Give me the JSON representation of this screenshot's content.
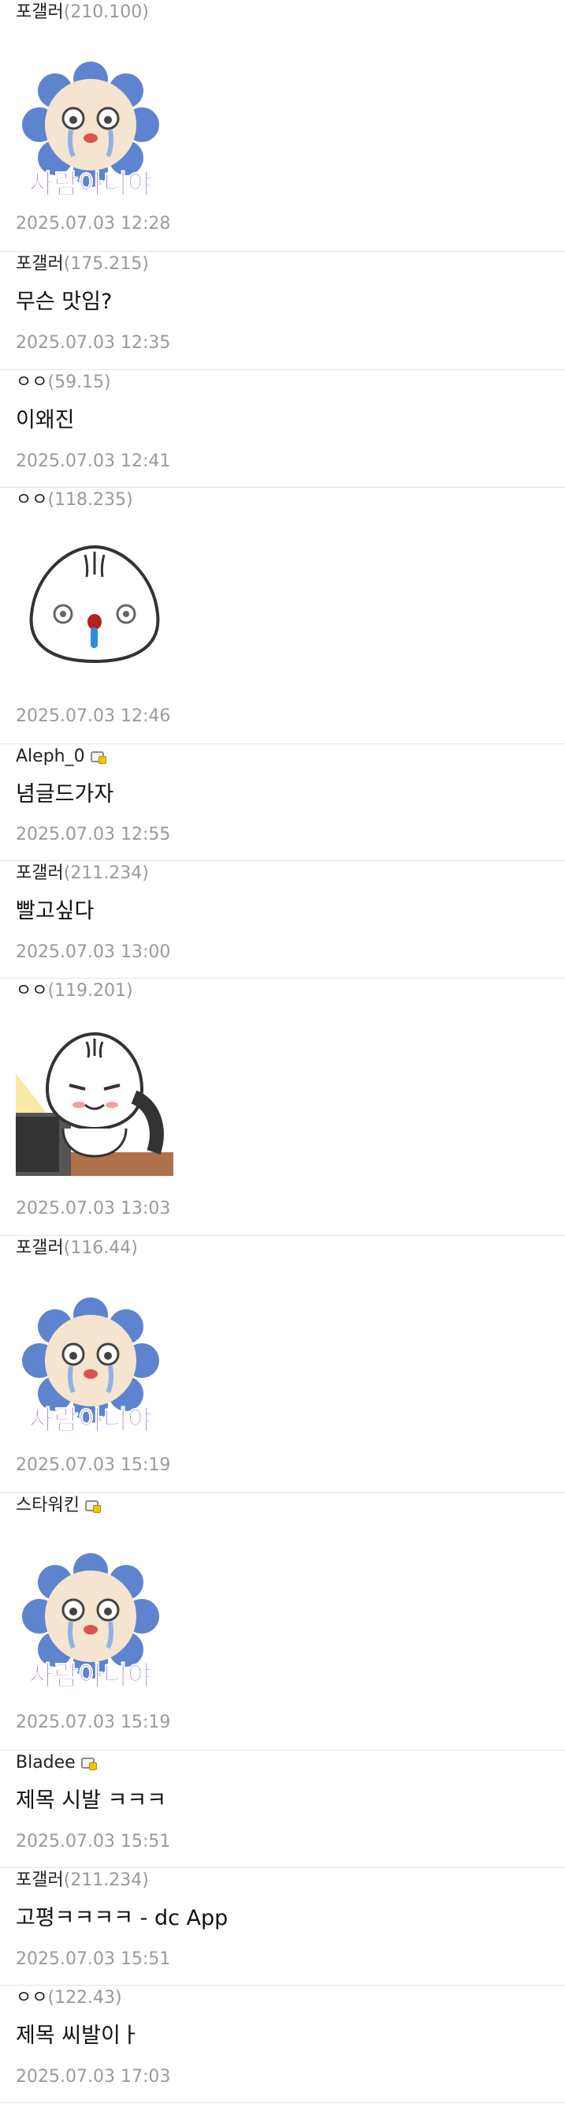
{
  "comments": [
    {
      "nick": "포갤러",
      "ip": "(210.100)",
      "date": "2025.07.03 12:28",
      "sticker": "crying-lion-sticker",
      "sticker_text": "사람아니야"
    },
    {
      "nick": "포갤러",
      "ip": "(175.215)",
      "text": "무슨 맛임?",
      "date": "2025.07.03 12:35"
    },
    {
      "nick": "ㅇㅇ",
      "ip": "(59.15)",
      "text": "이왜진",
      "date": "2025.07.03 12:41"
    },
    {
      "nick": "ㅇㅇ",
      "ip": "(118.235)",
      "date": "2025.07.03 12:46",
      "sticker": "dumpling-nosebleed-sticker"
    },
    {
      "nick": "Aleph_0",
      "fixed_icon": "fixed-nick-icon",
      "text": "념글드가자",
      "date": "2025.07.03 12:55"
    },
    {
      "nick": "포갤러",
      "ip": "(211.234)",
      "text": "빨고싶다",
      "date": "2025.07.03 13:00"
    },
    {
      "nick": "ㅇㅇ",
      "ip": "(119.201)",
      "date": "2025.07.03 13:03",
      "sticker": "dumpling-drooling-sticker"
    },
    {
      "nick": "포갤러",
      "ip": "(116.44)",
      "date": "2025.07.03 15:19",
      "sticker": "crying-lion-sticker",
      "sticker_text": "사람아니야"
    },
    {
      "nick": "스타워킨",
      "fixed_icon": "fixed-nick-icon",
      "date": "2025.07.03 15:19",
      "sticker": "crying-lion-sticker",
      "sticker_text": "사람아니야"
    },
    {
      "nick": "Bladee",
      "fixed_icon": "fixed-nick-icon",
      "text": "제목 시발 ㅋㅋㅋ",
      "date": "2025.07.03 15:51"
    },
    {
      "nick": "포갤러",
      "ip": "(211.234)",
      "text": "고평ㅋㅋㅋㅋ - dc App",
      "date": "2025.07.03 15:51"
    },
    {
      "nick": "ㅇㅇ",
      "ip": "(122.43)",
      "text": "제목 씨발이ㅏ",
      "date": "2025.07.03 17:03"
    }
  ]
}
